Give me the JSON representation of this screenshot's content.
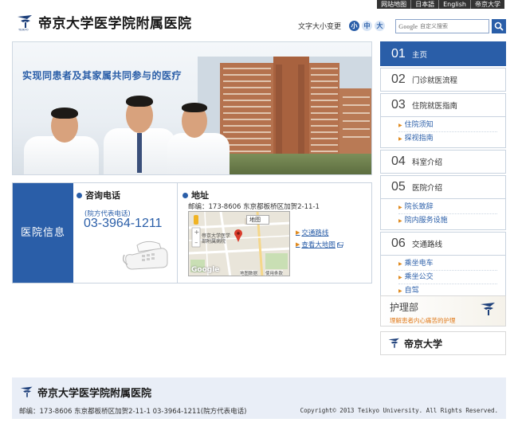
{
  "util_bar": {
    "items": [
      "网站地图",
      "日本語",
      "English",
      "帝京大学"
    ]
  },
  "header": {
    "logo_text": "帝京大学医学院附属医院",
    "font_size_label": "文字大小变更",
    "font_sizes": [
      "小",
      "中",
      "大"
    ],
    "search_brand": "Google",
    "search_placeholder": "自定义搜索"
  },
  "hero": {
    "slogan": "实现同患者及其家属共同参与的医疗"
  },
  "info": {
    "label": "医院信息",
    "tel_title": "咨询电话",
    "tel_sub": "(院方代表电话)",
    "tel_number": "03-3964-1211",
    "addr_title": "地址",
    "addr_text": "邮编：173-8606 东京都板桥区加贺2-11-1",
    "map_type": "地图",
    "map_place_label": "帝京大学医学部附属病院",
    "map_brand": "Google",
    "map_data": "地图数据",
    "map_terms": "使用条款",
    "links": [
      "交通路线",
      "查看大地图"
    ]
  },
  "nav": {
    "items": [
      {
        "num": "01",
        "label": "主页",
        "active": true
      },
      {
        "num": "02",
        "label": "门诊就医流程"
      },
      {
        "num": "03",
        "label": "住院就医指南",
        "subs": [
          "住院须知",
          "探视指南"
        ]
      },
      {
        "num": "04",
        "label": "科室介绍"
      },
      {
        "num": "05",
        "label": "医院介绍",
        "subs": [
          "院长致辞",
          "院内服务设施"
        ]
      },
      {
        "num": "06",
        "label": "交通路线",
        "subs": [
          "乘坐电车",
          "乘坐公交",
          "自驾"
        ]
      }
    ]
  },
  "banners": {
    "nursing_title": "护理部",
    "nursing_sub": "理解患者内心痛苦的护理",
    "univ_title": "帝京大学"
  },
  "footer": {
    "logo_text": "帝京大学医学院附属医院",
    "address": "邮编：173-8606 东京都板桥区加贺2-11-1  03-3964-1211(院方代表电话)",
    "copyright": "Copyright© 2013 Teikyo University. All Rights Reserved."
  },
  "colors": {
    "brand_blue": "#2a5ea8",
    "accent_orange": "#e08a1e",
    "footer_bg": "#e9eef7"
  }
}
